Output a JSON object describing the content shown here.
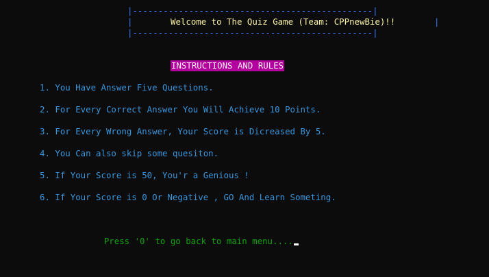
{
  "banner": {
    "top_border": "|-----------------------------------------------|",
    "middle_open": "|",
    "middle_close": "|",
    "bottom_border": "|-----------------------------------------------|",
    "welcome_text": "Welcome to The Quiz Game (Team: CPPnewBie)!!"
  },
  "heading": "INSTRUCTIONS AND RULES",
  "rules": [
    "1. You Have Answer Five Questions.",
    "2. For Every Correct Answer You Will Achieve 10 Points.",
    "3. For Every Wrong Answer, Your Score is Dicreased By 5.",
    "4. You Can also skip some quesiton.",
    "5. If Your Score is 50, You'r a Genious !",
    "6. If Your Score is 0 Or Negative , GO And Learn Someting."
  ],
  "prompt": "Press '0' to go back to main menu....",
  "colors": {
    "background": "#0c0c0c",
    "border": "#3b78ff",
    "welcome": "#f9f1a5",
    "heading_bg": "#b4009e",
    "rules": "#3a96dd",
    "prompt": "#13a10e"
  }
}
